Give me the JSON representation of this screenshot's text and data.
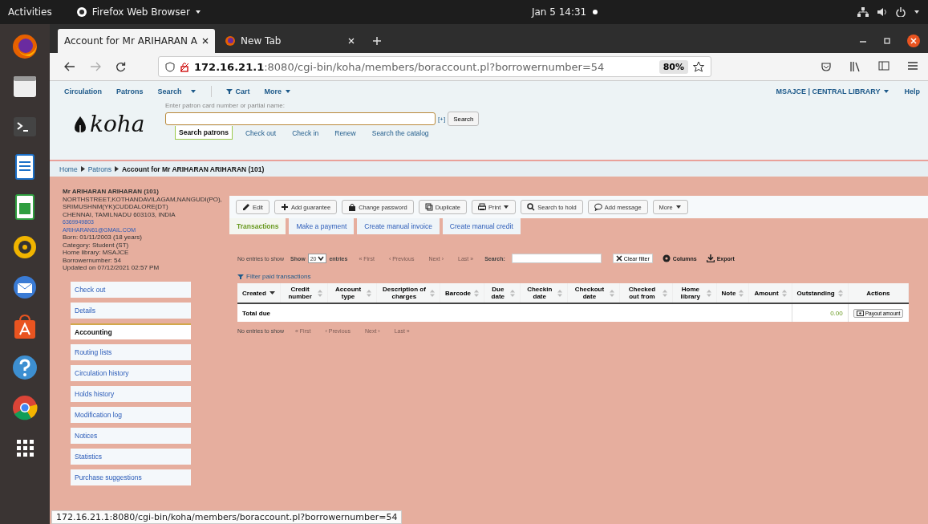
{
  "topbar": {
    "activities": "Activities",
    "app_menu": "Firefox Web Browser",
    "clock": "Jan 5  14:31"
  },
  "dock": [
    {
      "kind": "firefox"
    },
    {
      "kind": "files"
    },
    {
      "kind": "terminal"
    },
    {
      "kind": "writer"
    },
    {
      "kind": "calc"
    },
    {
      "kind": "music"
    },
    {
      "kind": "mail"
    },
    {
      "kind": "store"
    },
    {
      "kind": "help"
    },
    {
      "kind": "chrome"
    },
    {
      "kind": "grid"
    }
  ],
  "browser": {
    "tabs": [
      {
        "title": "Account for Mr ARIHARAN A",
        "selected": true
      },
      {
        "title": "New Tab",
        "selected": false
      }
    ],
    "url_host": "172.16.21.1",
    "url_rest": ":8080/cgi-bin/koha/members/boraccount.pl?borrowernumber=54",
    "zoom": "80%",
    "status_url": "172.16.21.1:8080/cgi-bin/koha/members/boraccount.pl?borrowernumber=54"
  },
  "koha_nav": {
    "items": [
      {
        "label": "Circulation",
        "kind": "link"
      },
      {
        "label": "Patrons",
        "kind": "link"
      },
      {
        "label": "Search",
        "kind": "link"
      },
      {
        "label": "Cart",
        "kind": "cart"
      },
      {
        "label": "More",
        "kind": "menu"
      }
    ],
    "library": "MSAJCE | CENTRAL LIBRARY",
    "help": "Help"
  },
  "header": {
    "logo": "koha",
    "search_label": "Enter patron card number or partial name:",
    "expand": "[+]",
    "search_button": "Search",
    "tabs": [
      {
        "label": "Search patrons",
        "selected": true
      },
      {
        "label": "Check out",
        "selected": false
      },
      {
        "label": "Check in",
        "selected": false
      },
      {
        "label": "Renew",
        "selected": false
      },
      {
        "label": "Search the catalog",
        "selected": false
      }
    ]
  },
  "breadcrumbs": [
    {
      "label": "Home",
      "kind": "link"
    },
    {
      "label": "Patrons",
      "kind": "link"
    },
    {
      "label": "Account for Mr ARIHARAN ARIHARAN (101)",
      "kind": "current"
    }
  ],
  "patron": {
    "name": "Mr ARIHARAN ARIHARAN (101)",
    "address": [
      "NORTHSTREET,KOTHANDAVILAGAM,NANGUDI(PO),",
      "SRIMUSHNM(YK)CUDDALORE(DT)",
      "CHENNAI, TAMILNADU 603103, INDIA"
    ],
    "phone": "6369949803",
    "email": "ARIHARAN61@GMAIL.COM",
    "details": [
      "Born: 01/11/2003 (18 years)",
      "Category: Student (ST)",
      "Home library: MSAJCE",
      "Borrowernumber: 54",
      "Updated on 07/12/2021 02:57 PM"
    ]
  },
  "sidebar": {
    "items": [
      {
        "label": "Check out",
        "selected": false
      },
      {
        "label": "Details",
        "selected": false
      },
      {
        "label": "Accounting",
        "selected": true
      },
      {
        "label": "Routing lists",
        "selected": false
      },
      {
        "label": "Circulation history",
        "selected": false
      },
      {
        "label": "Holds history",
        "selected": false
      },
      {
        "label": "Modification log",
        "selected": false
      },
      {
        "label": "Notices",
        "selected": false
      },
      {
        "label": "Statistics",
        "selected": false
      },
      {
        "label": "Purchase suggestions",
        "selected": false
      }
    ]
  },
  "toolbar": [
    {
      "label": "Edit",
      "kind": "pencil"
    },
    {
      "label": "Add guarantee",
      "kind": "plus"
    },
    {
      "label": "Change password",
      "kind": "lock"
    },
    {
      "label": "Duplicate",
      "kind": "copy"
    },
    {
      "label": "Print",
      "kind": "print"
    },
    {
      "label": "Search to hold",
      "kind": "search"
    },
    {
      "label": "Add message",
      "kind": "comment"
    },
    {
      "label": "More",
      "kind": "more"
    }
  ],
  "account_tabs": [
    {
      "label": "Transactions",
      "selected": true
    },
    {
      "label": "Make a payment",
      "selected": false
    },
    {
      "label": "Create manual invoice",
      "selected": false
    },
    {
      "label": "Create manual credit",
      "selected": false
    }
  ],
  "table_controls": {
    "info": "No entries to show",
    "show_label": "Show",
    "page_size": "20",
    "entries_label": "entries",
    "pager": [
      {
        "label": "« First",
        "disabled": true
      },
      {
        "label": "‹ Previous",
        "disabled": true
      },
      {
        "label": "Next ›",
        "disabled": true
      },
      {
        "label": "Last »",
        "disabled": true
      }
    ],
    "search_label": "Search:",
    "clear_filter": "Clear filter",
    "columns": "Columns",
    "export": "Export",
    "filter_link": "Filter paid transactions"
  },
  "table": {
    "columns": [
      {
        "label": "Created",
        "kind": "sorted"
      },
      {
        "label": "Credit number",
        "kind": "sortable"
      },
      {
        "label": "Account type",
        "kind": "sortable"
      },
      {
        "label": "Description of charges",
        "kind": "sortable"
      },
      {
        "label": "Barcode",
        "kind": "sortable"
      },
      {
        "label": "Due date",
        "kind": "sortable"
      },
      {
        "label": "Checkin date",
        "kind": "sortable"
      },
      {
        "label": "Checkout date",
        "kind": "sortable"
      },
      {
        "label": "Checked out from",
        "kind": "sortable"
      },
      {
        "label": "Home library",
        "kind": "sortable"
      },
      {
        "label": "Note",
        "kind": "sortable"
      },
      {
        "label": "Amount",
        "kind": "sortable"
      },
      {
        "label": "Outstanding",
        "kind": "sortable"
      },
      {
        "label": "Actions",
        "kind": "plain"
      }
    ],
    "footer": {
      "label": "Total due",
      "outstanding": "0.00",
      "action": "Payout amount"
    }
  },
  "bottom_controls": {
    "info": "No entries to show",
    "pager": [
      {
        "label": "« First",
        "disabled": true
      },
      {
        "label": "‹ Previous",
        "disabled": true
      },
      {
        "label": "Next ›",
        "disabled": true
      },
      {
        "label": "Last »",
        "disabled": true
      }
    ]
  }
}
